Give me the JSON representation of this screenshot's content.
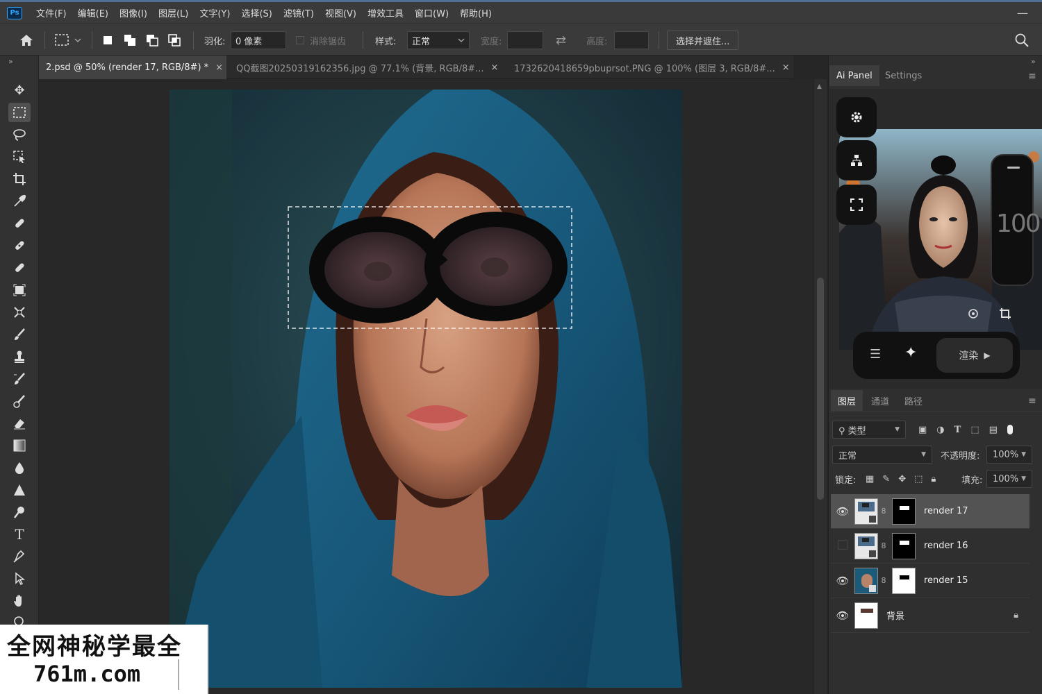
{
  "app": {
    "logo": "Ps"
  },
  "menu": [
    "文件(F)",
    "编辑(E)",
    "图像(I)",
    "图层(L)",
    "文字(Y)",
    "选择(S)",
    "滤镜(T)",
    "视图(V)",
    "增效工具",
    "窗口(W)",
    "帮助(H)"
  ],
  "window": {
    "minimize": "—"
  },
  "options": {
    "feather_label": "羽化:",
    "feather_value": "0 像素",
    "antialias_label": "消除锯齿",
    "style_label": "样式:",
    "style_value": "正常",
    "width_label": "宽度:",
    "height_label": "高度:",
    "select_mask_button": "选择并遮住..."
  },
  "tabs": [
    {
      "label": "2.psd @ 50% (render 17, RGB/8#) *"
    },
    {
      "label": "QQ截图20250319162356.jpg @ 77.1% (背景, RGB/8#..."
    },
    {
      "label": "1732620418659pbuprsot.PNG @ 100% (图层 3, RGB/8#..."
    }
  ],
  "tab_close": "×",
  "right_tabs": {
    "ai_panel": "Ai Panel",
    "settings": "Settings"
  },
  "ai": {
    "slider_value": "100",
    "render_label": "渲染"
  },
  "layer_tabs": {
    "layers": "图层",
    "channels": "通道",
    "paths": "路径"
  },
  "layers_panel": {
    "filter_type": "类型",
    "blend_mode": "正常",
    "opacity_label": "不透明度:",
    "opacity_value": "100%",
    "lock_label": "锁定:",
    "fill_label": "填充:",
    "fill_value": "100%",
    "layers": [
      {
        "name": "render 17",
        "visible": true,
        "selected": true
      },
      {
        "name": "render 16",
        "visible": false,
        "selected": false
      },
      {
        "name": "render 15",
        "visible": true,
        "selected": false
      },
      {
        "name": "背景",
        "visible": true,
        "selected": false,
        "locked": true
      }
    ]
  },
  "watermark": {
    "line1": "全网神秘学最全",
    "line2": "761m.com"
  },
  "colors": {
    "accent": "#31a8ff",
    "bg": "#262626",
    "panel": "#2f2f2f",
    "bar": "#3a3a3a"
  }
}
